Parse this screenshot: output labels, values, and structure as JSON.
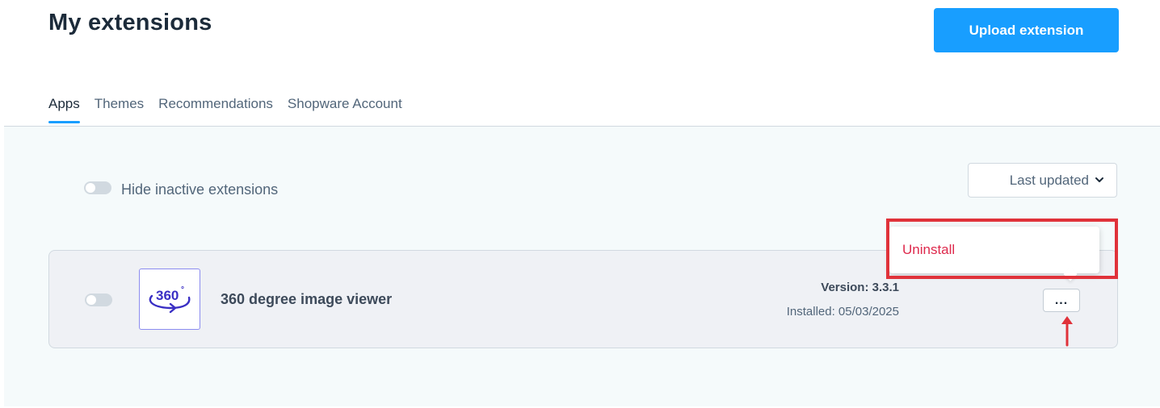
{
  "header": {
    "title": "My extensions",
    "upload_button": "Upload extension"
  },
  "tabs": [
    {
      "label": "Apps",
      "active": true
    },
    {
      "label": "Themes",
      "active": false
    },
    {
      "label": "Recommendations",
      "active": false
    },
    {
      "label": "Shopware Account",
      "active": false
    }
  ],
  "filters": {
    "hide_inactive_label": "Hide inactive extensions",
    "hide_inactive_enabled": false,
    "sort_label": "Last updated",
    "sort_icon": "chevron-down-icon"
  },
  "extension": {
    "name": "360 degree image viewer",
    "icon_text": "360",
    "icon_degree": "°",
    "version": "Version: 3.3.1",
    "installed": "Installed: 05/03/2025",
    "active": false,
    "more_label": "..."
  },
  "context_menu": {
    "items": [
      {
        "label": "Uninstall"
      }
    ]
  },
  "colors": {
    "accent": "#189eff",
    "danger": "#de294c",
    "annotation": "#e0323a"
  }
}
